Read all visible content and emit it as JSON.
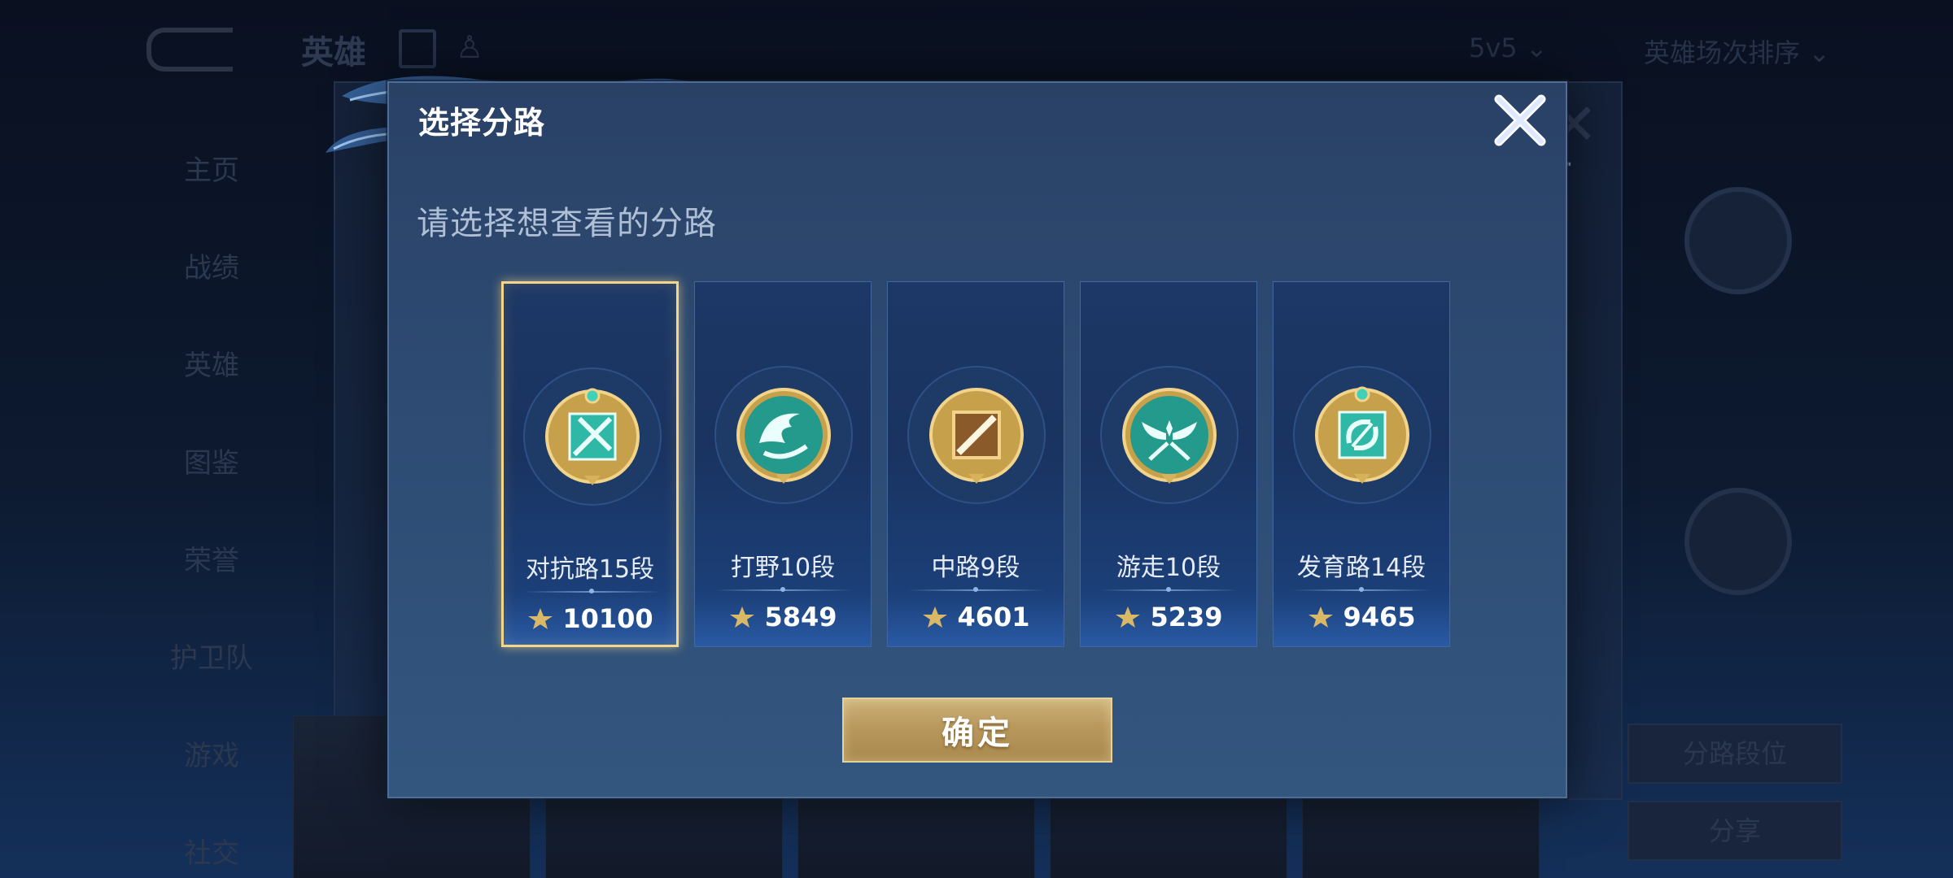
{
  "background": {
    "title": "英雄",
    "subtitle": "",
    "mode": "5v5",
    "sort": "英雄场次排序",
    "sidebar": [
      "主页",
      "战绩",
      "英雄",
      "图鉴",
      "荣誉",
      "护卫队",
      "游戏",
      "社交"
    ],
    "right_buttons": [
      "分路段位",
      "分享"
    ]
  },
  "modal": {
    "title": "选择分路",
    "subtitle": "请选择想查看的分路",
    "confirm_label": "确定",
    "lanes": [
      {
        "label": "对抗路15段",
        "points": "10100",
        "icon": "sword-clash-icon",
        "selected": true
      },
      {
        "label": "打野10段",
        "points": "5849",
        "icon": "dragon-icon",
        "selected": false
      },
      {
        "label": "中路9段",
        "points": "4601",
        "icon": "staff-icon",
        "selected": false
      },
      {
        "label": "游走10段",
        "points": "5239",
        "icon": "wings-icon",
        "selected": false
      },
      {
        "label": "发育路14段",
        "points": "9465",
        "icon": "bow-icon",
        "selected": false
      }
    ]
  },
  "colors": {
    "modal_bg": "#2d4a72",
    "lane_bg": "#1b3a6c",
    "selected_border": "#f3d68a",
    "confirm_gold": "#b8985c",
    "badge_teal": "#2fb8a6"
  }
}
